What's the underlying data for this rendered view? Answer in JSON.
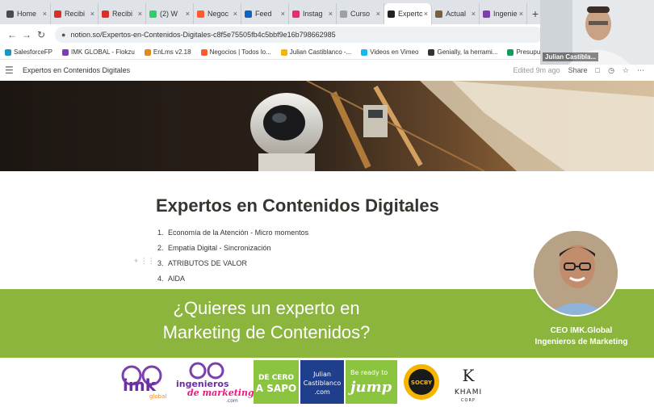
{
  "browser": {
    "tabs": [
      {
        "label": "Home",
        "favicon_color": "#4a4a4a",
        "active": false
      },
      {
        "label": "Recibi",
        "favicon_color": "#d93025",
        "active": false
      },
      {
        "label": "Recibi",
        "favicon_color": "#d93025",
        "active": false
      },
      {
        "label": "(2) W",
        "favicon_color": "#25d366",
        "active": false
      },
      {
        "label": "Negoc",
        "favicon_color": "#ff5a2d",
        "active": false
      },
      {
        "label": "Feed",
        "favicon_color": "#0a66c2",
        "active": false
      },
      {
        "label": "Instag",
        "favicon_color": "#e1306c",
        "active": false
      },
      {
        "label": "Curso",
        "favicon_color": "#9aa0a6",
        "active": false
      },
      {
        "label": "Experto",
        "favicon_color": "#222222",
        "active": true
      },
      {
        "label": "Actual",
        "favicon_color": "#7b5e3b",
        "active": false
      },
      {
        "label": "Ingenie",
        "favicon_color": "#7b3fb0",
        "active": false
      }
    ],
    "new_tab_label": "+",
    "url": "notion.so/Expertos-en-Contenidos-Digitales-c8f5e75505fb4c5bbf9e16b798662985",
    "bookmarks": [
      {
        "label": "SalesforceFP",
        "favicon_color": "#1798c1"
      },
      {
        "label": "IMK GLOBAL - Flokzu",
        "favicon_color": "#7b3fb0"
      },
      {
        "label": "EnLms v2.18",
        "favicon_color": "#e08a1e"
      },
      {
        "label": "Negocios | Todos lo...",
        "favicon_color": "#ff5a2d"
      },
      {
        "label": "Julian Castiblanco -...",
        "favicon_color": "#f4b400"
      },
      {
        "label": "Videos en Vimeo",
        "favicon_color": "#1ab7ea"
      },
      {
        "label": "Genially, la herrami...",
        "favicon_color": "#333333"
      },
      {
        "label": "Presupuesto Famili...",
        "favicon_color": "#0f9d58"
      }
    ]
  },
  "notion": {
    "breadcrumb": "Expertos en Contenidos Digitales",
    "edited": "Edited 9m ago",
    "share_label": "Share",
    "page_title": "Expertos en Contenidos Digitales",
    "list_items": [
      {
        "num": "1.",
        "text": "Economía de la Atención - Micro momentos"
      },
      {
        "num": "2.",
        "text": "Empatía Digital - Sincronización"
      },
      {
        "num": "3.",
        "text": "ATRIBUTOS DE VALOR"
      },
      {
        "num": "4.",
        "text": "AIDA"
      }
    ]
  },
  "webcam": {
    "name": "Julian Castibla..."
  },
  "banner": {
    "headline_line1": "¿Quieres un experto en",
    "headline_line2": "Marketing de Contenidos?",
    "ceo_line1": "CEO IMK.Global",
    "ceo_line2": "Ingenieros de Marketing",
    "color": "#8bb53c"
  },
  "logos": {
    "imk": "imk",
    "imk_sub": "global",
    "ingenieros_line1": "ingenieros",
    "ingenieros_line2": "de marketing",
    "ingenieros_sub": ".com",
    "sapo_line1": "DE CERO",
    "sapo_line2": "A SAPO",
    "julian_line1": "Julian",
    "julian_line2": "Castiblanco",
    "julian_line3": ".com",
    "jump_line1": "Be ready to",
    "jump_line2": "jump",
    "socby": "SOCBY",
    "khami_line1": "KHAMI",
    "khami_line2": "CORP"
  }
}
